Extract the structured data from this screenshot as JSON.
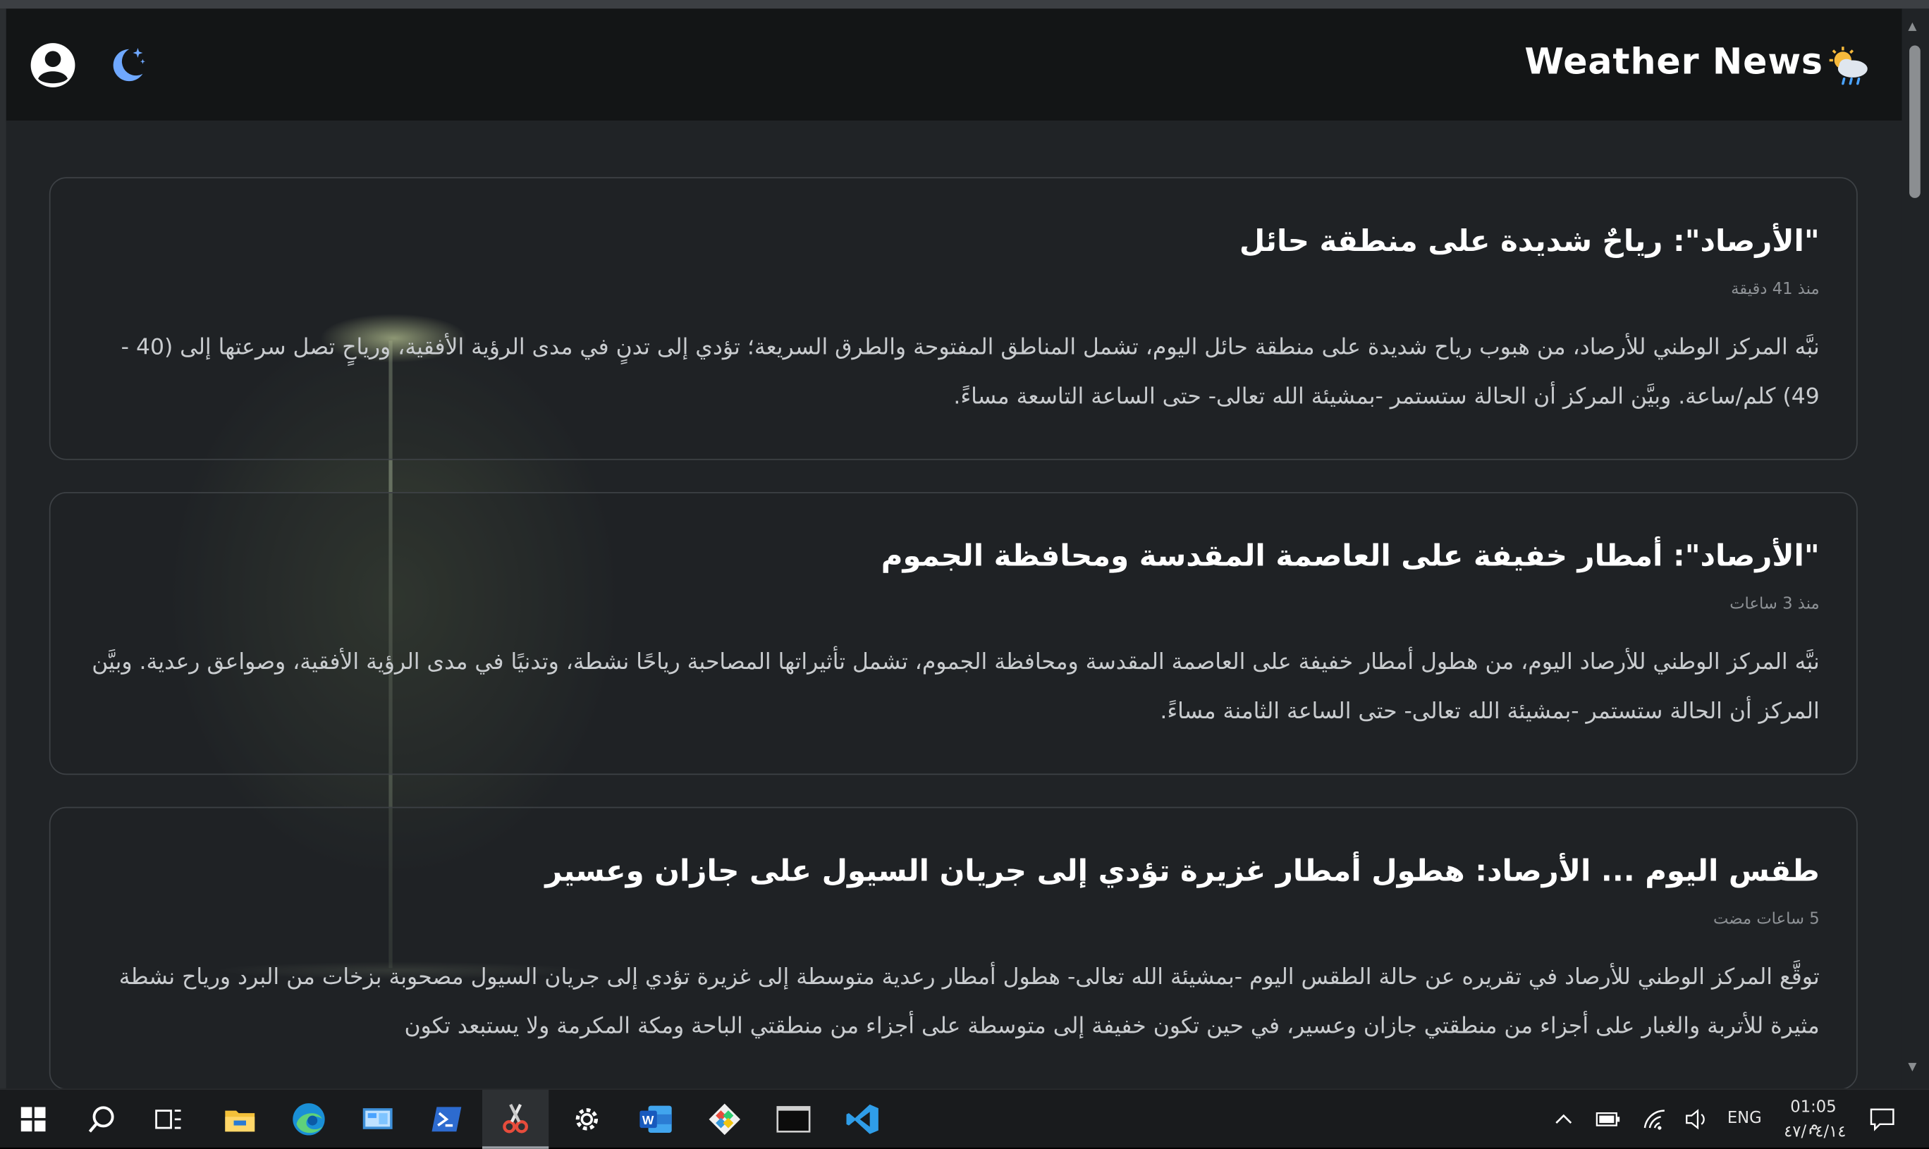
{
  "app": {
    "title": "Weather News",
    "title_icon": "weather-cloud-sun-rain-icon",
    "account_icon": "account-circle-icon",
    "theme_icon": "dark-mode-moon-icon"
  },
  "news": [
    {
      "title": "\"الأرصاد\": رياحٌ شديدة على منطقة حائل",
      "time": "منذ 41 دقيقة",
      "body": "نبَّه المركز الوطني للأرصاد، من هبوب رياح شديدة على منطقة حائل اليوم، تشمل المناطق المفتوحة والطرق السريعة؛ تؤدي إلى تدنٍ في مدى الرؤية الأفقية، ورياحٍ تصل سرعتها إلى (40 - 49) كلم/ساعة. وبيَّن المركز أن الحالة ستستمر -بمشيئة الله تعالى- حتى الساعة التاسعة مساءً."
    },
    {
      "title": "\"الأرصاد\": أمطار خفيفة على العاصمة المقدسة ومحافظة الجموم",
      "time": "منذ 3 ساعات",
      "body": "نبَّه المركز الوطني للأرصاد اليوم، من هطول أمطار خفيفة على العاصمة المقدسة ومحافظة الجموم، تشمل تأثيراتها المصاحبة رياحًا نشطة، وتدنيًا في مدى الرؤية الأفقية، وصواعق رعدية. وبيَّن المركز أن الحالة ستستمر -بمشيئة الله تعالى- حتى الساعة الثامنة مساءً."
    },
    {
      "title": "طقس اليوم ... الأرصاد: هطول أمطار غزيرة تؤدي إلى جريان السيول على جازان وعسير",
      "time": "5 ساعات مضت",
      "body": "توقَّع المركز الوطني للأرصاد في تقريره عن حالة الطقس اليوم -بمشيئة الله تعالى- هطول أمطار رعدية متوسطة إلى غزيرة تؤدي إلى جريان السيول مصحوبة بزخات من البرد ورياح نشطة مثيرة للأتربة والغبار على أجزاء من منطقتي جازان وعسير، في حين تكون خفيفة إلى متوسطة على أجزاء من منطقتي الباحة ومكة المكرمة ولا يستبعد تكون"
    }
  ],
  "taskbar": {
    "apps": [
      "windows-start-icon",
      "search-icon",
      "task-view-icon",
      "file-explorer-icon",
      "edge-browser-icon",
      "control-panel-icon",
      "powershell-icon",
      "snipping-tool-icon",
      "settings-gear-icon",
      "word-icon",
      "git-icon",
      "terminal-icon",
      "vscode-icon"
    ],
    "language": "ENG",
    "time": "01:05 م",
    "date": "٤٧/٠٤/١٤"
  }
}
